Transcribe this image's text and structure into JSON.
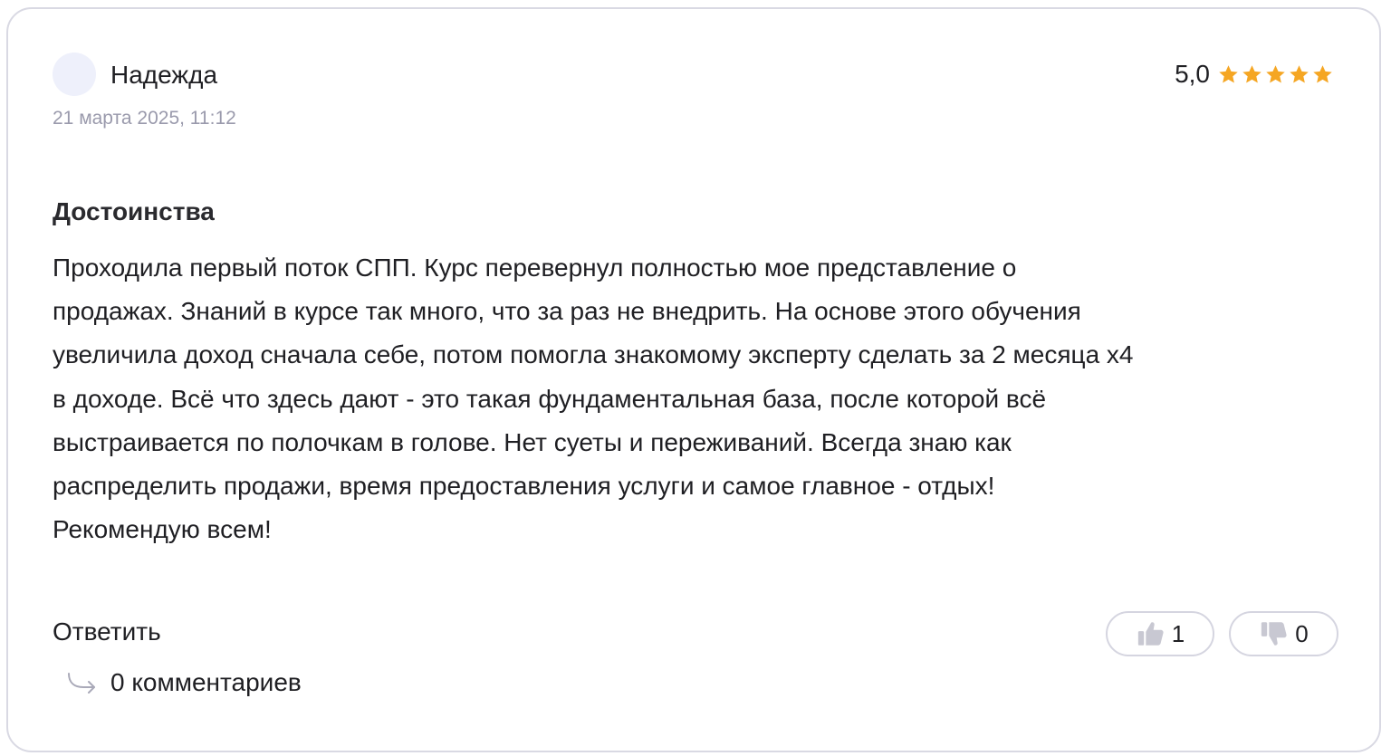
{
  "review": {
    "author": "Надежда",
    "date": "21 марта 2025, 11:12",
    "rating": {
      "value": "5,0",
      "stars": 5,
      "star_color": "#f5a623"
    },
    "section_title": "Достоинства",
    "text": "Проходила первый поток СПП. Курс перевернул полностью мое представление о\nпродажах. Знаний в курсе так много, что за раз не внедрить. На основе этого обучения\nувеличила доход сначала себе, потом помогла знакомому эксперту сделать за 2 месяца х4\nв доходе. Всё что здесь дают - это такая фундаментальная база, после которой всё\nвыстраивается по полочкам в голове. Нет суеты и переживаний. Всегда знаю как\nраспределить продажи, время предоставления услуги и самое главное - отдых!\nРекомендую всем!"
  },
  "actions": {
    "reply_label": "Ответить",
    "comments_label": "0 комментариев",
    "comments_icon": "reply-arrow-icon",
    "likes": {
      "count": "1",
      "icon": "thumbs-up-icon"
    },
    "dislikes": {
      "count": "0",
      "icon": "thumbs-down-icon"
    }
  },
  "colors": {
    "border": "#d9d9e3",
    "muted_text": "#9a9aac",
    "avatar_bg": "#eef0fb",
    "icon_gray": "#c8c8d2"
  }
}
